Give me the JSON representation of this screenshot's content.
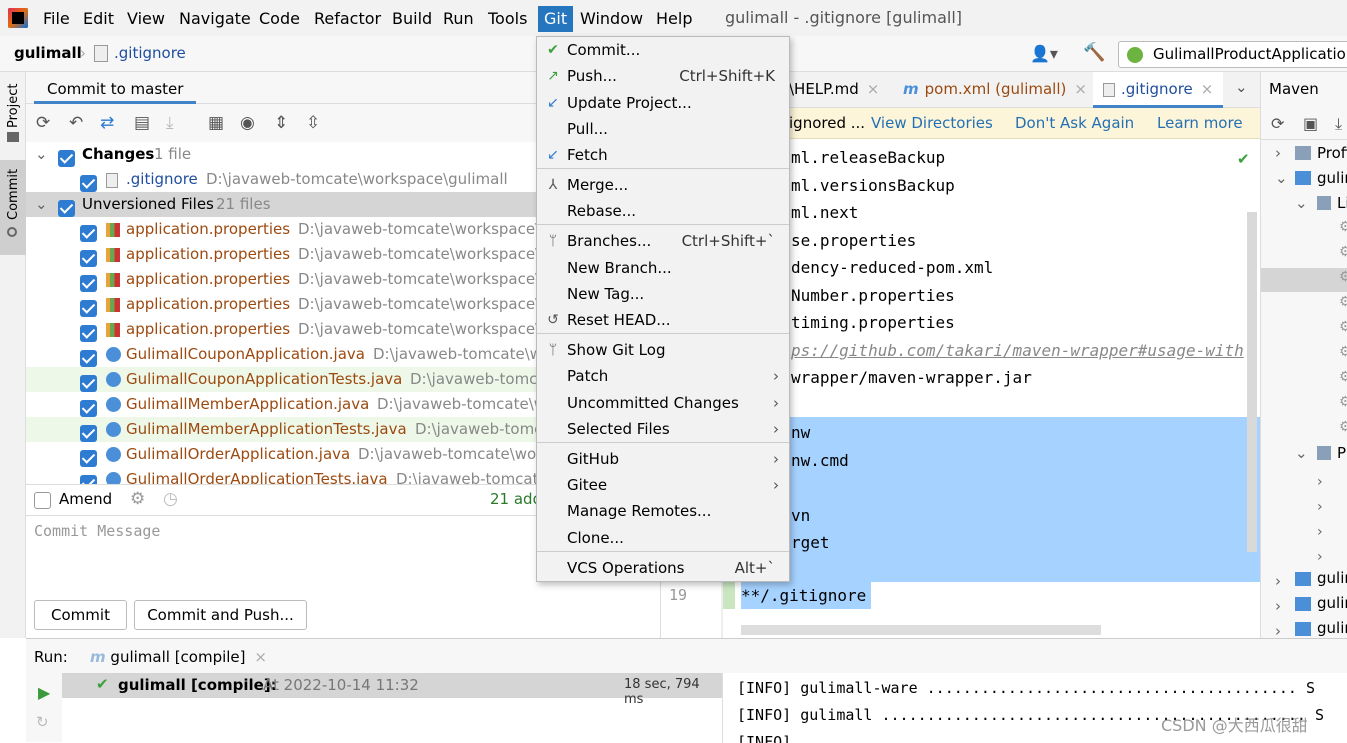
{
  "menubar": {
    "items": [
      "File",
      "Edit",
      "View",
      "Navigate",
      "Code",
      "Refactor",
      "Build",
      "Run",
      "Tools",
      "Git",
      "Window",
      "Help"
    ],
    "title": "gulimall - .gitignore [gulimall]"
  },
  "navbar": {
    "project": "gulimall",
    "file": ".gitignore",
    "run_config": "GulimallProductApplication"
  },
  "left_stripe": {
    "project": "Project",
    "commit": "Commit"
  },
  "commit_panel": {
    "title": "Commit to master",
    "changes": {
      "label": "Changes",
      "count": "1 file"
    },
    "changed_file": {
      "name": ".gitignore",
      "path": "D:\\javaweb-tomcate\\workspace\\gulimall"
    },
    "unversioned": {
      "label": "Unversioned Files",
      "count": "21 files"
    },
    "files": [
      {
        "name": "application.properties",
        "path": "D:\\javaweb-tomcate\\workspace\\g"
      },
      {
        "name": "application.properties",
        "path": "D:\\javaweb-tomcate\\workspace\\g"
      },
      {
        "name": "application.properties",
        "path": "D:\\javaweb-tomcate\\workspace\\g"
      },
      {
        "name": "application.properties",
        "path": "D:\\javaweb-tomcate\\workspace\\g"
      },
      {
        "name": "application.properties",
        "path": "D:\\javaweb-tomcate\\workspace\\g"
      },
      {
        "name": "GulimallCouponApplication.java",
        "path": "D:\\javaweb-tomcate\\wo"
      },
      {
        "name": "GulimallCouponApplicationTests.java",
        "path": "D:\\javaweb-tomca"
      },
      {
        "name": "GulimallMemberApplication.java",
        "path": "D:\\javaweb-tomcate\\w"
      },
      {
        "name": "GulimallMemberApplicationTests.java",
        "path": "D:\\javaweb-tomca"
      },
      {
        "name": "GulimallOrderApplication.java",
        "path": "D:\\javaweb-tomcate\\work"
      },
      {
        "name": "GulimallOrderApplicationTests.java",
        "path": "D:\\javaweb-tomcate"
      }
    ],
    "amend": "Amend",
    "added": "21 add",
    "message_placeholder": "Commit Message",
    "commit_button": "Commit",
    "commit_push_button": "Commit and Push..."
  },
  "editor": {
    "tabs": [
      "\\HELP.md",
      "pom.xml (gulimall)",
      ".gitignore"
    ],
    "banner": {
      "text": "ignored ...",
      "view_dirs": "View Directories",
      "dont_ask": "Don't Ask Again",
      "learn": "Learn more"
    },
    "lines": [
      "ml.releaseBackup",
      "ml.versionsBackup",
      "ml.next",
      "se.properties",
      "dency-reduced-pom.xml",
      "Number.properties",
      "timing.properties",
      "ps://github.com/takari/maven-wrapper#usage-with",
      "wrapper/maven-wrapper.jar",
      "",
      "nw",
      "nw.cmd",
      "",
      "vn",
      "rget",
      ""
    ],
    "last_line_number": "19",
    "last_line": "**/.gitignore"
  },
  "maven": {
    "title": "Maven",
    "items": [
      "Profi",
      "gulir",
      "Li",
      "P",
      "gulir",
      "gulir",
      "gulir"
    ]
  },
  "run_panel": {
    "label": "Run:",
    "tab": "gulimall [compile]",
    "item": "gulimall [compile]:",
    "item_time": "At 2022-10-14 11:32",
    "duration": "18 sec, 794 ms",
    "console": [
      "[INFO] gulimall-ware ......................................... S",
      "[INFO] gulimall ............................................... S",
      "[INFO]"
    ],
    "watermark": "CSDN @大西瓜很甜"
  },
  "git_menu": [
    {
      "label": "Commit...",
      "icon": "check-icon",
      "shortcut": ""
    },
    {
      "label": "Push...",
      "icon": "push-arrow-icon",
      "shortcut": "Ctrl+Shift+K"
    },
    {
      "label": "Update Project...",
      "icon": "update-arrow-icon",
      "shortcut": ""
    },
    {
      "label": "Pull...",
      "icon": "",
      "shortcut": ""
    },
    {
      "label": "Fetch",
      "icon": "fetch-icon",
      "shortcut": ""
    },
    {
      "label": "Merge...",
      "icon": "merge-icon",
      "shortcut": ""
    },
    {
      "label": "Rebase...",
      "icon": "",
      "shortcut": ""
    },
    {
      "label": "Branches...",
      "icon": "branch-icon",
      "shortcut": "Ctrl+Shift+`"
    },
    {
      "label": "New Branch...",
      "icon": "",
      "shortcut": ""
    },
    {
      "label": "New Tag...",
      "icon": "",
      "shortcut": ""
    },
    {
      "label": "Reset HEAD...",
      "icon": "reset-icon",
      "shortcut": ""
    },
    {
      "label": "Show Git Log",
      "icon": "git-log-icon",
      "shortcut": ""
    },
    {
      "label": "Patch",
      "icon": "",
      "shortcut": ""
    },
    {
      "label": "Uncommitted Changes",
      "icon": "",
      "shortcut": ""
    },
    {
      "label": "Selected Files",
      "icon": "",
      "shortcut": ""
    },
    {
      "label": "GitHub",
      "icon": "",
      "shortcut": ""
    },
    {
      "label": "Gitee",
      "icon": "",
      "shortcut": ""
    },
    {
      "label": "Manage Remotes...",
      "icon": "",
      "shortcut": ""
    },
    {
      "label": "Clone...",
      "icon": "",
      "shortcut": ""
    },
    {
      "label": "VCS Operations",
      "icon": "",
      "shortcut": "Alt+`"
    }
  ]
}
